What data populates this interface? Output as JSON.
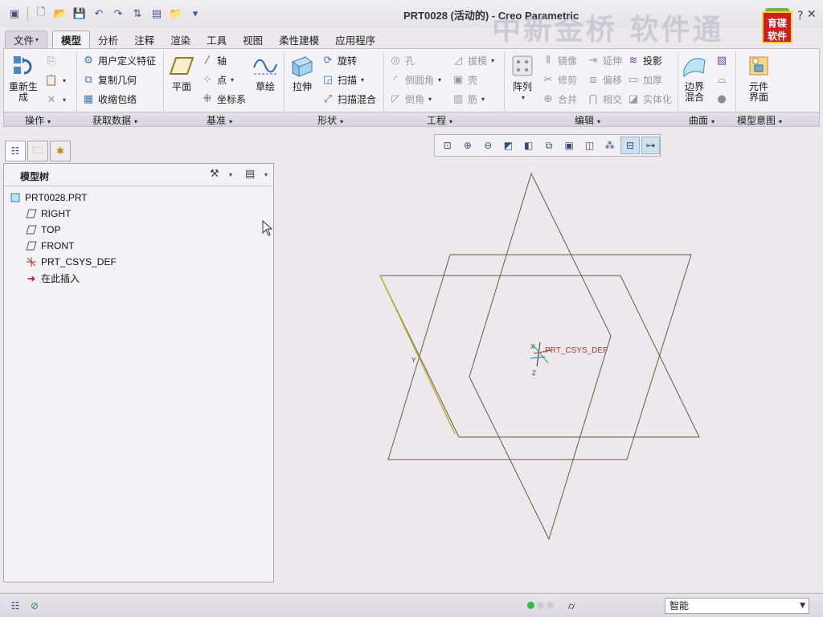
{
  "window": {
    "title": "PRT0028 (活动的) - Creo Parametric",
    "watermark": "中新金桥 软件通",
    "logo_text": "育碟软件"
  },
  "tabs": [
    {
      "label": "文件",
      "id": "file"
    },
    {
      "label": "模型",
      "id": "model"
    },
    {
      "label": "分析",
      "id": "analysis"
    },
    {
      "label": "注释",
      "id": "annotate"
    },
    {
      "label": "渲染",
      "id": "render"
    },
    {
      "label": "工具",
      "id": "tools"
    },
    {
      "label": "视图",
      "id": "view"
    },
    {
      "label": "柔性建模",
      "id": "flexible"
    },
    {
      "label": "应用程序",
      "id": "apps"
    }
  ],
  "ribbon": {
    "operations": {
      "regenerate": "重新生成",
      "label": "操作"
    },
    "get_data": {
      "udf": "用户定义特征",
      "copy_geometry": "复制几何",
      "shrinkwrap": "收缩包络",
      "label": "获取数据"
    },
    "datum": {
      "plane": "平面",
      "axis": "轴",
      "point": "点",
      "csys": "坐标系",
      "sketch": "草绘",
      "label": "基准"
    },
    "shapes": {
      "extrude": "拉伸",
      "revolve": "旋转",
      "sweep": "扫描",
      "swept_blend": "扫描混合",
      "label": "形状"
    },
    "engineering": {
      "hole": "孔",
      "draft": "拔模",
      "round": "倒圆角",
      "shell": "壳",
      "chamfer": "倒角",
      "rib": "筋",
      "label": "工程"
    },
    "editing": {
      "pattern": "阵列",
      "mirror": "镜像",
      "extend": "延伸",
      "project": "投影",
      "trim": "修剪",
      "offset": "偏移",
      "thicken": "加厚",
      "merge": "合并",
      "intersect": "相交",
      "solidify": "实体化",
      "label": "编辑"
    },
    "surfaces": {
      "boundary_blend": "边界混合",
      "label": "曲面"
    },
    "model_intent": {
      "component_interface": "元件界面",
      "label": "模型意图"
    }
  },
  "model_tree": {
    "title": "模型树",
    "items": [
      {
        "label": "PRT0028.PRT",
        "icon": "part-icon"
      },
      {
        "label": "RIGHT",
        "icon": "datum-plane-icon"
      },
      {
        "label": "TOP",
        "icon": "datum-plane-icon"
      },
      {
        "label": "FRONT",
        "icon": "datum-plane-icon"
      },
      {
        "label": "PRT_CSYS_DEF",
        "icon": "csys-icon"
      },
      {
        "label": "在此插入",
        "icon": "insert-here-arrow-icon"
      }
    ]
  },
  "viewport": {
    "csys_label": "PRT_CSYS_DEF",
    "axis_x": "X",
    "axis_y": "Y",
    "axis_z": "Z"
  },
  "statusbar": {
    "filter_value": "智能"
  },
  "colors": {
    "accent": "#2e4d7c",
    "datum_plane_edge": "#6b5a3a",
    "active_status": "#2eb84d"
  }
}
